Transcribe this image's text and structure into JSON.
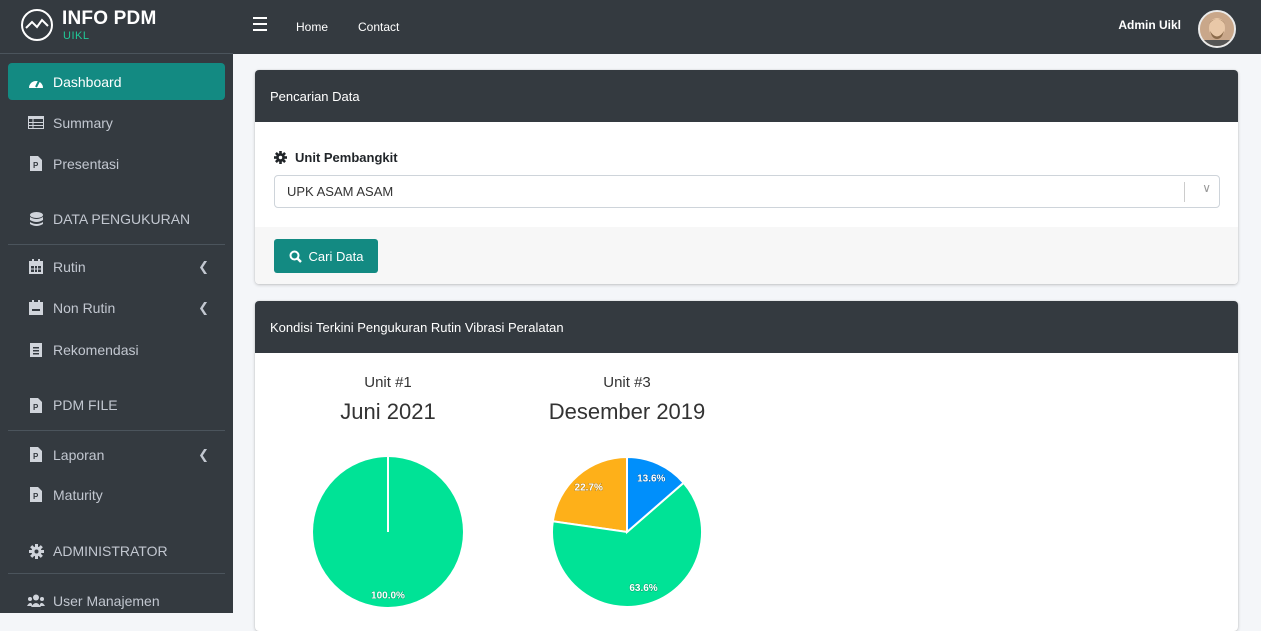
{
  "brand": {
    "title": "INFO PDM",
    "subtitle": "UIKL"
  },
  "topbar": {
    "links": [
      "Home",
      "Contact"
    ],
    "user": "Admin Uikl"
  },
  "sidebar": {
    "items": [
      {
        "label": "Dashboard",
        "icon": "dashboard-icon",
        "active": true
      },
      {
        "label": "Summary",
        "icon": "table-icon"
      },
      {
        "label": "Presentasi",
        "icon": "powerpoint-file-icon"
      },
      {
        "label": "DATA PENGUKURAN",
        "icon": "database-icon",
        "header": true
      },
      {
        "label": "Rutin",
        "icon": "calendar-icon",
        "arrow": true
      },
      {
        "label": "Non Rutin",
        "icon": "calendar-minus-icon",
        "arrow": true
      },
      {
        "label": "Rekomendasi",
        "icon": "clipboard-list-icon"
      },
      {
        "label": "PDM FILE",
        "icon": "file-icon",
        "header": true
      },
      {
        "label": "Laporan",
        "icon": "powerpoint-file-icon",
        "arrow": true
      },
      {
        "label": "Maturity",
        "icon": "powerpoint-file-icon"
      },
      {
        "label": "ADMINISTRATOR",
        "icon": "gear-icon",
        "header": true
      },
      {
        "label": "User Manajemen",
        "icon": "users-icon"
      }
    ]
  },
  "search_card": {
    "title": "Pencarian Data",
    "field_label": "Unit Pembangkit",
    "selected": "UPK ASAM ASAM",
    "button": "Cari Data"
  },
  "chart_card": {
    "title": "Kondisi Terkini Pengukuran Rutin Vibrasi Peralatan"
  },
  "colors": {
    "green": "#00e396",
    "blue": "#008ffb",
    "orange": "#feb019",
    "dark": "#343a40",
    "teal": "#138a82"
  },
  "chart_data": [
    {
      "type": "pie",
      "unit": "Unit #1",
      "title": "Juni 2021",
      "slices": [
        {
          "value": 100.0,
          "label": "100.0%",
          "color": "#00e396"
        }
      ]
    },
    {
      "type": "pie",
      "unit": "Unit #3",
      "title": "Desember 2019",
      "slices": [
        {
          "value": 13.6,
          "label": "13.6%",
          "color": "#008ffb"
        },
        {
          "value": 63.6,
          "label": "63.6%",
          "color": "#00e396"
        },
        {
          "value": 22.7,
          "label": "22.7%",
          "color": "#feb019"
        }
      ]
    }
  ]
}
